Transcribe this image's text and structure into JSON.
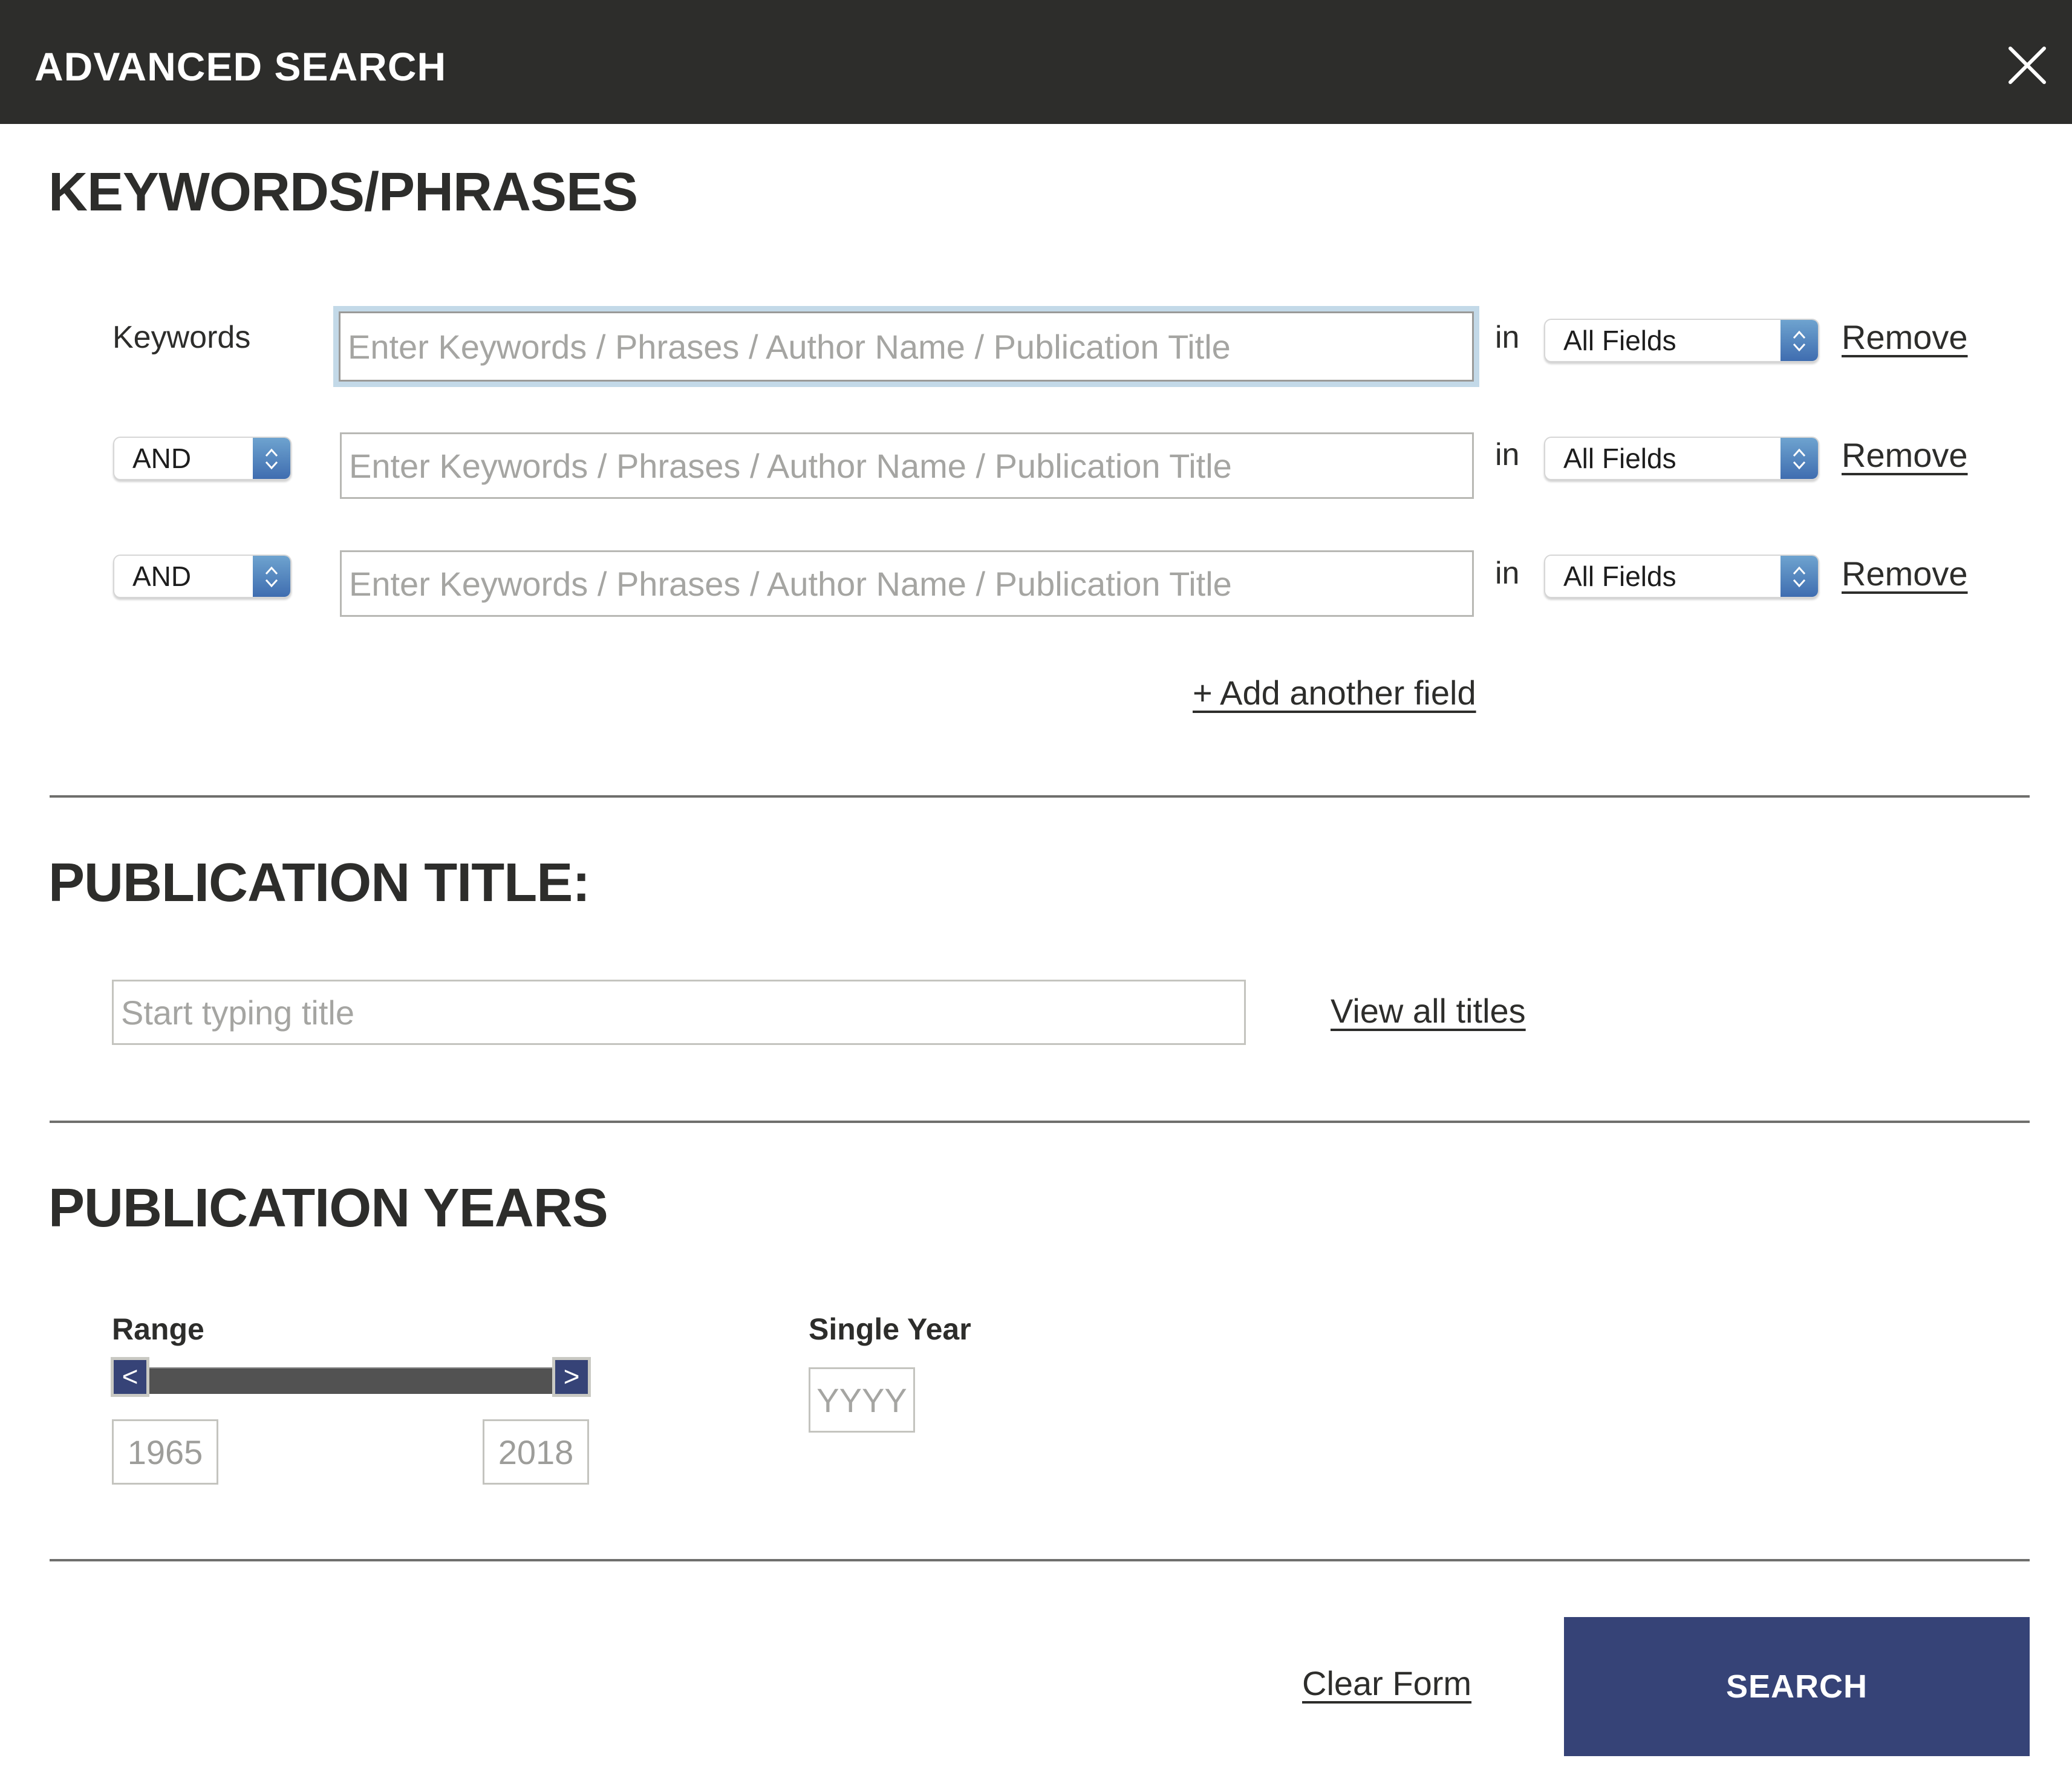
{
  "header": {
    "title": "ADVANCED SEARCH",
    "close_icon": "close-icon"
  },
  "keywords_section": {
    "heading": "KEYWORDS/PHRASES",
    "rows": [
      {
        "label": "Keywords",
        "operator": null,
        "placeholder": "Enter Keywords / Phrases / Author Name / Publication Title",
        "value": "",
        "focused": true,
        "in_label": "in",
        "field": "All Fields",
        "remove_label": "Remove"
      },
      {
        "label": null,
        "operator": "AND",
        "placeholder": "Enter Keywords / Phrases / Author Name / Publication Title",
        "value": "",
        "focused": false,
        "in_label": "in",
        "field": "All Fields",
        "remove_label": "Remove"
      },
      {
        "label": null,
        "operator": "AND",
        "placeholder": "Enter Keywords / Phrases / Author Name / Publication Title",
        "value": "",
        "focused": false,
        "in_label": "in",
        "field": "All Fields",
        "remove_label": "Remove"
      }
    ],
    "add_field_label": "+ Add another field"
  },
  "publication_title_section": {
    "heading": "PUBLICATION TITLE:",
    "placeholder": "Start typing title",
    "value": "",
    "view_all_label": "View all titles"
  },
  "publication_years_section": {
    "heading": "PUBLICATION YEARS",
    "range": {
      "label": "Range",
      "min_year": "1965",
      "max_year": "2018",
      "handle_left_glyph": "<",
      "handle_right_glyph": ">",
      "selected_fraction_start": 0,
      "selected_fraction_end": 1
    },
    "single_year": {
      "label": "Single Year",
      "placeholder": "YYYY",
      "value": ""
    }
  },
  "footer": {
    "clear_label": "Clear Form",
    "search_label": "SEARCH"
  },
  "colors": {
    "header_bg": "#2d2d2b",
    "primary_button": "#364377",
    "focus_ring": "#c3d9e8",
    "select_accent": "#4f7fbf",
    "slider_track": "#525252"
  }
}
